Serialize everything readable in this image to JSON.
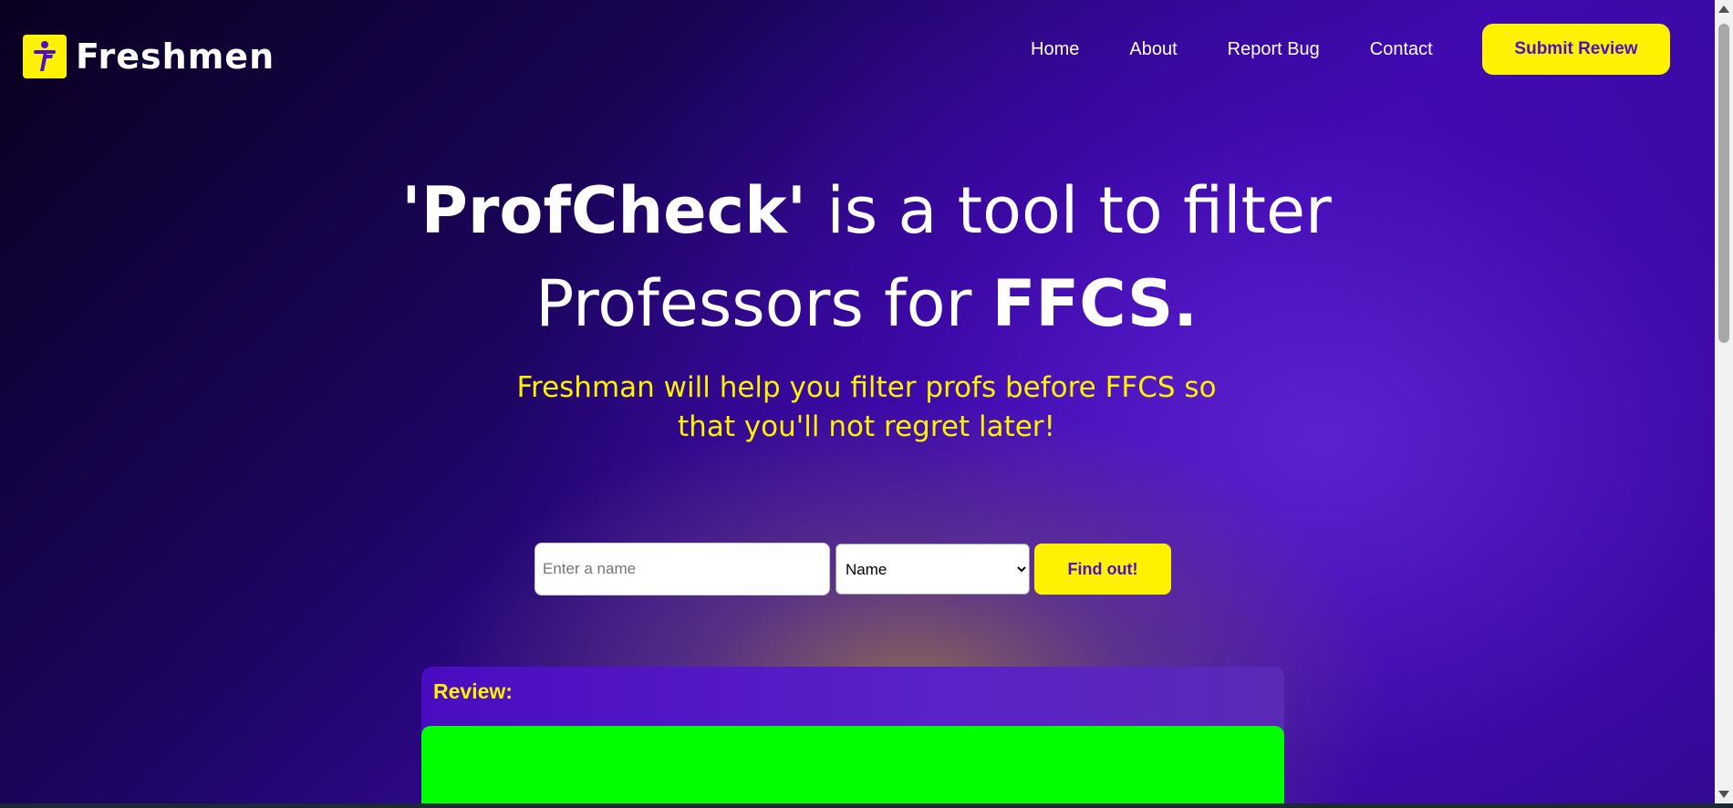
{
  "header": {
    "logo_text": "Freshmen",
    "logo_icon": "freshmen-f-logo",
    "nav": [
      {
        "label": "Home"
      },
      {
        "label": "About"
      },
      {
        "label": "Report Bug"
      },
      {
        "label": "Contact"
      }
    ],
    "cta_label": "Submit Review"
  },
  "hero": {
    "title_part1_bold": "'ProfCheck'",
    "title_part2": " is a tool to filter Professors for ",
    "title_part3_bold": "FFCS.",
    "subtitle": "Freshman will help you filter profs before FFCS so that you'll not regret later!"
  },
  "search": {
    "placeholder": "Enter a name",
    "value": "",
    "filter_selected": "Name",
    "button_label": "Find out!"
  },
  "review": {
    "label": "Review:"
  },
  "colors": {
    "accent_yellow": "#fff200",
    "brand_purple": "#4b10c8",
    "review_card_green": "#00ff00"
  }
}
